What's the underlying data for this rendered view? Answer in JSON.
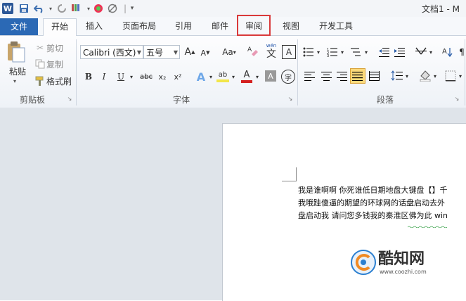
{
  "quick_access": {
    "app_icon": "word-icon",
    "items": [
      "save-icon",
      "undo-icon",
      "redo-icon",
      "format-painter-icon",
      "color-icon",
      "clear-icon",
      "customize-icon"
    ]
  },
  "title": {
    "text": "文档1 - M"
  },
  "tabs": {
    "file": "文件",
    "home": "开始",
    "insert": "插入",
    "layout": "页面布局",
    "references": "引用",
    "mailings": "邮件",
    "review": "审阅",
    "view": "视图",
    "developer": "开发工具"
  },
  "ribbon": {
    "clipboard": {
      "paste": "粘贴",
      "cut": "剪切",
      "copy": "复制",
      "format_painter": "格式刷",
      "label": "剪贴板"
    },
    "font": {
      "font_name": "Calibri (西文)",
      "font_size": "五号",
      "grow": "A",
      "shrink": "A",
      "case": "Aa",
      "bold": "B",
      "italic": "I",
      "underline": "U",
      "strike": "abc",
      "subscript": "x₂",
      "superscript": "x²",
      "text_effect": "A",
      "highlight": "ab",
      "font_color": "A",
      "char_shading": "A",
      "enclose": "字",
      "phonetic": "wén",
      "phonetic_char": "文",
      "border_char": "A",
      "label": "字体"
    },
    "paragraph": {
      "label": "段落"
    },
    "styles": {
      "label": "A"
    }
  },
  "document": {
    "lines": [
      "我是谁啊啊 你死谁低日期地盘大键盘【】千",
      "我哦跬傻逼的期望的环球网的话盘启动去外",
      "盘启动我 请问您多钱我的秦淮区佛为此 win"
    ]
  },
  "watermark": {
    "name": "酷知网",
    "url": "www.coozhi.com"
  },
  "colors": {
    "file_tab": "#2b69b5",
    "highlight_box": "#d9393a",
    "highlight_yellow": "#f2e64a",
    "font_red": "#d42020"
  }
}
